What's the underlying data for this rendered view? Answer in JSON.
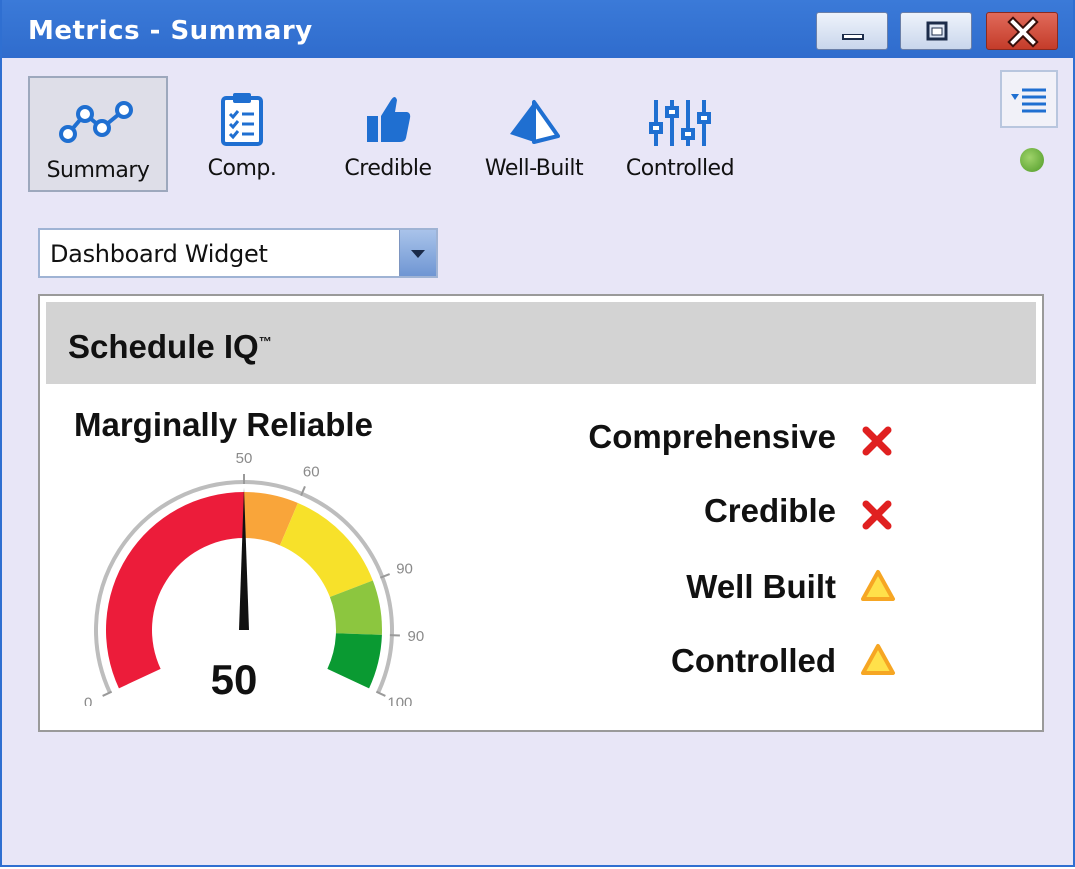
{
  "window": {
    "title": "Metrics - Summary"
  },
  "toolbar": {
    "items": [
      {
        "label": "Summary",
        "icon": "chart-line-icon",
        "selected": true
      },
      {
        "label": "Comp.",
        "icon": "clipboard-checklist-icon",
        "selected": false
      },
      {
        "label": "Credible",
        "icon": "thumbs-up-icon",
        "selected": false
      },
      {
        "label": "Well-Built",
        "icon": "pyramid-icon",
        "selected": false
      },
      {
        "label": "Controlled",
        "icon": "sliders-icon",
        "selected": false
      }
    ]
  },
  "view_selector": {
    "selected": "Dashboard Widget"
  },
  "panel": {
    "title": "Schedule IQ",
    "trademark": "™",
    "rating": "Marginally Reliable",
    "gauge": {
      "value": 50,
      "value_label": "50",
      "min": 0,
      "max": 100,
      "tick_labels": [
        "0",
        "50",
        "60",
        "90",
        "90",
        "100"
      ],
      "colors": {
        "red": "#ec1c3a",
        "orange": "#f9a53a",
        "yellow": "#f7e12a",
        "light_green": "#8cc63f",
        "green": "#0a9a32"
      }
    },
    "metrics": [
      {
        "label": "Comprehensive",
        "status": "fail",
        "icon": "x-icon"
      },
      {
        "label": "Credible",
        "status": "fail",
        "icon": "x-icon"
      },
      {
        "label": "Well Built",
        "status": "warning",
        "icon": "warning-triangle-icon"
      },
      {
        "label": "Controlled",
        "status": "warning",
        "icon": "warning-triangle-icon"
      }
    ]
  },
  "colors": {
    "titlebar": "#2f6fd1",
    "window_bg": "#e8e6f7",
    "fail": "#e02020",
    "warning": "#f9c43a"
  }
}
